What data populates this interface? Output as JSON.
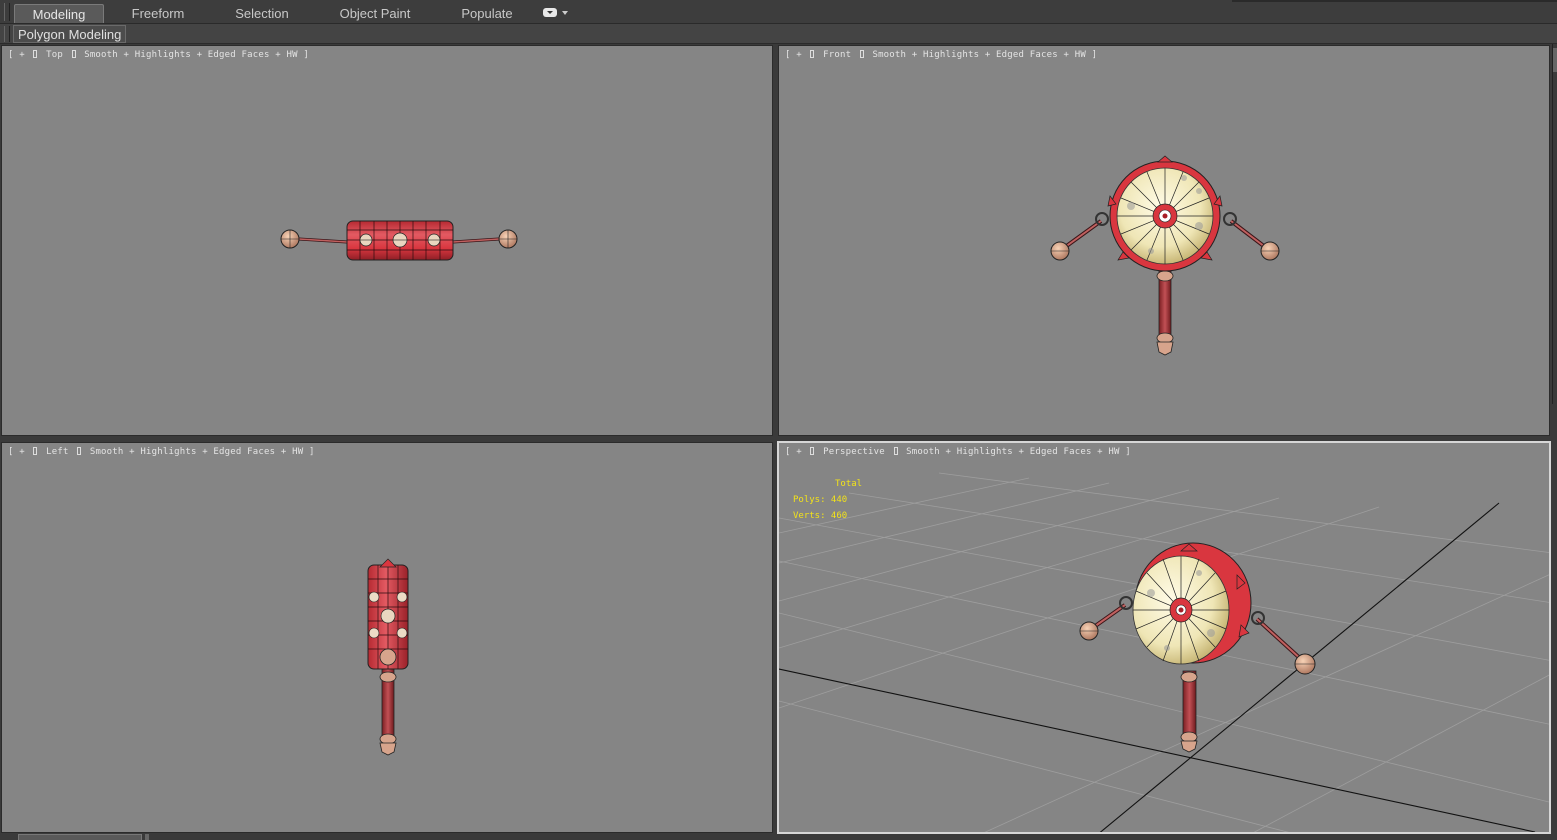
{
  "ribbon": {
    "tabs": [
      {
        "label": "Modeling",
        "active": true
      },
      {
        "label": "Freeform"
      },
      {
        "label": "Selection"
      },
      {
        "label": "Object Paint"
      },
      {
        "label": "Populate"
      }
    ],
    "menu_icon": "chevron-down-icon"
  },
  "panel": {
    "label": "Polygon Modeling"
  },
  "viewports": {
    "top": {
      "open": "[ + ",
      "view": " Top ",
      "mode": " Smooth + Highlights + Edged Faces + HW ]"
    },
    "front": {
      "open": "[ + ",
      "view": " Front ",
      "mode": " Smooth + Highlights + Edged Faces + HW ]"
    },
    "left": {
      "open": "[ + ",
      "view": " Left ",
      "mode": " Smooth + Highlights + Edged Faces + HW ]"
    },
    "perspective": {
      "open": "[ + ",
      "view": " Perspective ",
      "mode": " Smooth + Highlights + Edged Faces + HW ]"
    }
  },
  "stats": {
    "total": "Total",
    "polys": "Polys: 440",
    "verts": "Verts: 460"
  },
  "colors": {
    "viewport_bg": "#858585",
    "drum_red": "#d9363f",
    "drum_face": "#f0ecc6",
    "stats_text": "#f2e21a"
  }
}
